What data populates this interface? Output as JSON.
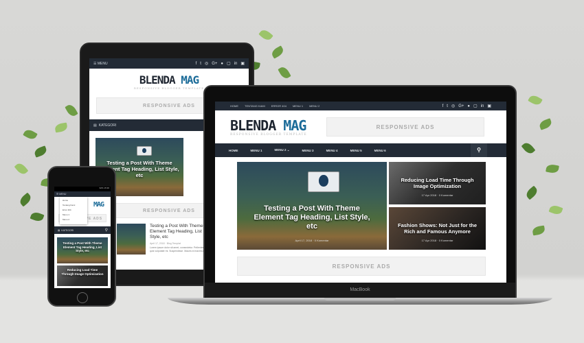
{
  "brand": {
    "name_dark": "BLENDA",
    "name_accent": "MAG",
    "tagline": "RESPONSIVE BLOGGER TEMPLATE",
    "accent_color": "#1c6c99",
    "nav_color": "#232b36"
  },
  "ads_label": "RESPONSIVE ADS",
  "top_links": [
    "HOME",
    "TENTANG KAMI",
    "ERROR 404",
    "MENU 1",
    "MENU 2"
  ],
  "social_icons": [
    "f",
    "t",
    "rss",
    "G+",
    "p",
    "ig",
    "in",
    "yt"
  ],
  "nav_menu": [
    "HOME",
    "MENU 1",
    "MENU 2 ⌄",
    "MENU 3",
    "MENU 4",
    "MENU 5",
    "MENU 6"
  ],
  "menu_label": "MENU",
  "kategori_label": "KATEGORI",
  "posts": {
    "featured": {
      "title": "Testing a Post With Theme Element Tag Heading, List Style, etc",
      "date": "April 17, 2018",
      "comments": "0 Komentar"
    },
    "second": {
      "title": "Reducing Load Time Through Image Optimization",
      "date": "17 Apr 2018",
      "comments": "0 Komentar"
    },
    "third": {
      "title": "Fashion Shows: Not Just for the Rich and Famous Anymore",
      "date": "17 Apr 2018",
      "comments": "0 Komentar"
    }
  },
  "tablet_list_post": {
    "title": "Testing a Post With Theme Element Tag Heading, List Style, etc",
    "date": "April 17, 2018",
    "author": "Blog Templat",
    "excerpt": "Lorem ipsum dolor sit amet, consectetur. Pellentesque quis vulputate mi. Suspendisse. Mauris id maximus..."
  },
  "phone_dropdown": [
    "Home",
    "Tentang Kami",
    "Error 404",
    "Menu 1",
    "Menu 2"
  ],
  "phone_status": "62% 15:36",
  "laptop_label": "MacBook"
}
